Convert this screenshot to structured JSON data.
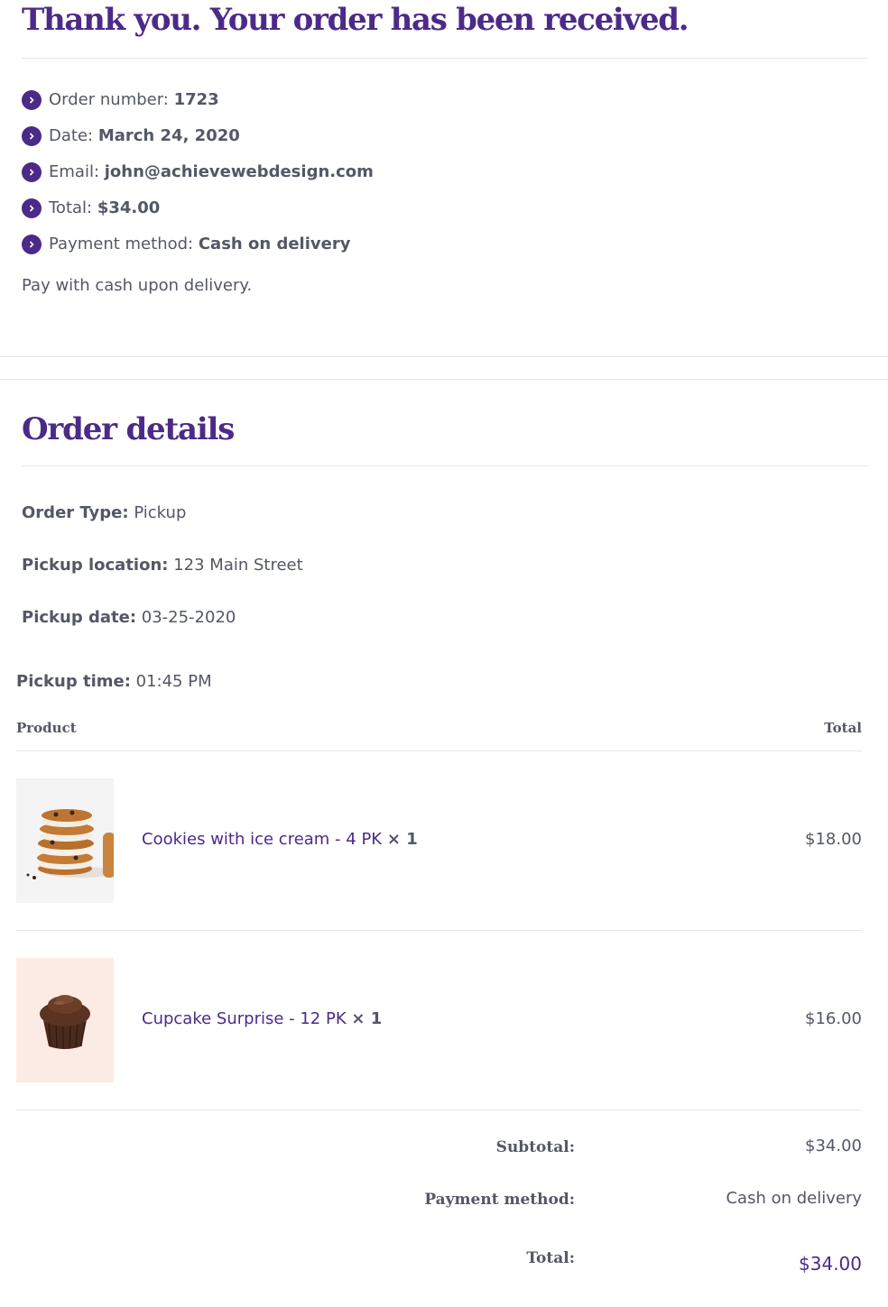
{
  "heading": "Thank you. Your order has been received.",
  "overview": [
    {
      "label": "Order number:",
      "value": "1723"
    },
    {
      "label": "Date:",
      "value": "March 24, 2020"
    },
    {
      "label": "Email:",
      "value": "john@achievewebdesign.com"
    },
    {
      "label": "Total:",
      "value": "$34.00"
    },
    {
      "label": "Payment method:",
      "value": "Cash on delivery"
    }
  ],
  "payment_note": "Pay with cash upon delivery.",
  "order_details": {
    "heading": "Order details",
    "order_type": {
      "label": "Order Type:",
      "value": "Pickup"
    },
    "pickup_location": {
      "label": "Pickup location:",
      "value": "123 Main Street"
    },
    "pickup_date": {
      "label": "Pickup date:",
      "value": "03-25-2020"
    },
    "pickup_time": {
      "label": "Pickup time:",
      "value": "01:45 PM"
    }
  },
  "table": {
    "headers": {
      "product": "Product",
      "total": "Total"
    },
    "rows": [
      {
        "name": "Cookies with ice cream - 4 PK",
        "qty": "× 1",
        "total": "$18.00",
        "image": "cookies-image"
      },
      {
        "name": "Cupcake Surprise - 12 PK",
        "qty": "× 1",
        "total": "$16.00",
        "image": "cupcake-image"
      }
    ],
    "footer": [
      {
        "label": "Subtotal:",
        "value": "$34.00"
      },
      {
        "label": "Payment method:",
        "value": "Cash on delivery"
      },
      {
        "label": "Total:",
        "value": "$34.00"
      }
    ]
  },
  "colors": {
    "accent": "#4c2a88",
    "text": "#545765",
    "divider": "#e7e7ec"
  }
}
